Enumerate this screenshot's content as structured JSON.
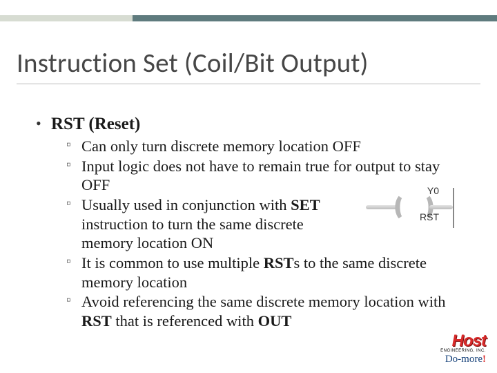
{
  "title": "Instruction Set (Coil/Bit Output)",
  "bullet": "RST (Reset)",
  "subitems": {
    "i1": "Can only turn discrete memory location OFF",
    "i2": "Input logic does not have to remain true for output to stay OFF",
    "i3_a": "Usually used in conjunction with ",
    "i3_b": "SET",
    "i3_c": " instruction to turn the same discrete memory location ON",
    "i4_a": "It is common to use multiple ",
    "i4_b": "RST",
    "i4_c": "s to the same discrete memory location",
    "i5_a": "Avoid referencing the same discrete memory location with ",
    "i5_b": "RST",
    "i5_c": " that is referenced with ",
    "i5_d": "OUT"
  },
  "coil": {
    "top_label": "Y0",
    "bottom_label": "RST"
  },
  "logo": {
    "brand": "Host",
    "sub": "ENGINEERING, INC.",
    "tag": "Do-more",
    "excl": "!"
  }
}
